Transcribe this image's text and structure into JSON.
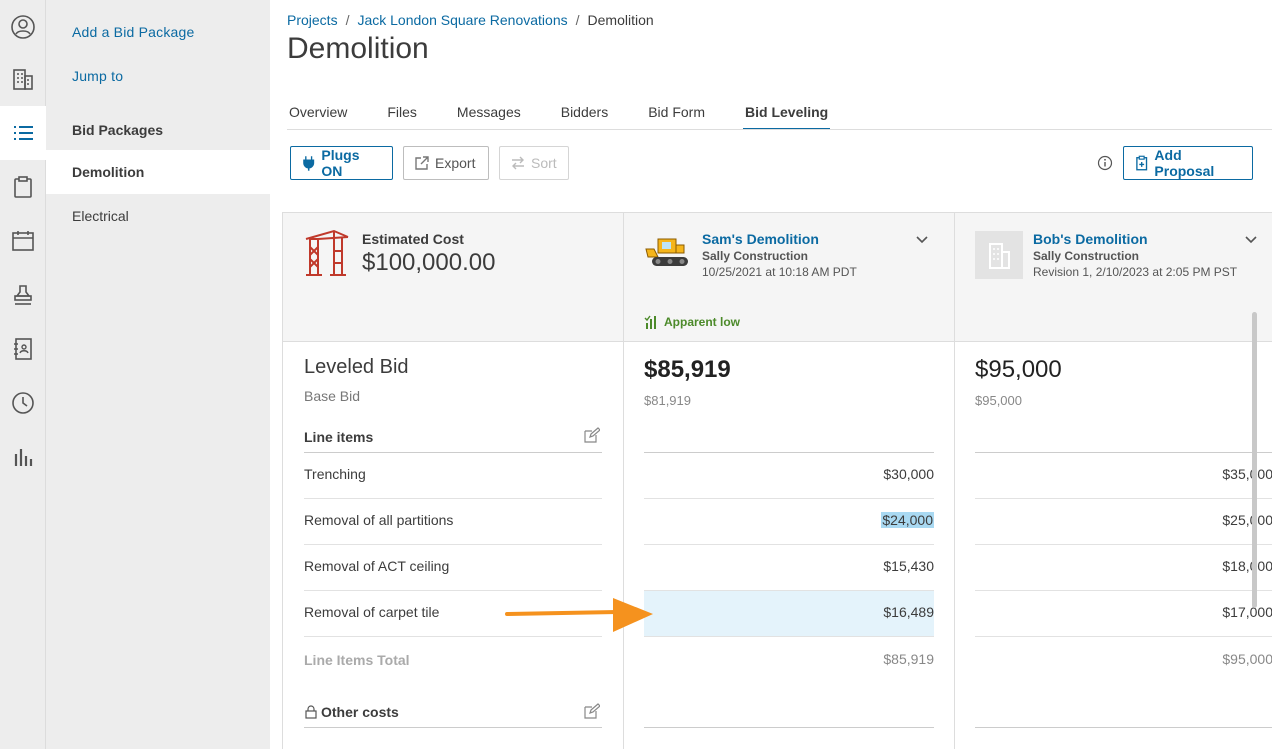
{
  "nav": {
    "icons": [
      "user-circle-icon",
      "building-icon",
      "list-icon",
      "clipboard-icon",
      "calendar-icon",
      "stamp-icon",
      "address-book-icon",
      "clock-icon",
      "bar-chart-icon"
    ]
  },
  "sidebar": {
    "add_bid_package": "Add a Bid Package",
    "jump_to": "Jump to",
    "section_title": "Bid Packages",
    "items": [
      {
        "label": "Demolition"
      },
      {
        "label": "Electrical"
      }
    ]
  },
  "breadcrumb": {
    "projects": "Projects",
    "project": "Jack London Square Renovations",
    "current": "Demolition",
    "separator": "/"
  },
  "page_title": "Demolition",
  "tabs": [
    {
      "label": "Overview"
    },
    {
      "label": "Files"
    },
    {
      "label": "Messages"
    },
    {
      "label": "Bidders"
    },
    {
      "label": "Bid Form"
    },
    {
      "label": "Bid Leveling"
    }
  ],
  "toolbar": {
    "plugs_label": "Plugs ON",
    "export_label": "Export",
    "sort_label": "Sort",
    "add_proposal_label": "Add Proposal"
  },
  "estimate": {
    "label": "Estimated Cost",
    "value": "$100,000.00"
  },
  "bidders": [
    {
      "name": "Sam's Demolition",
      "company": "Sally Construction",
      "date": "10/25/2021 at 10:18 AM PDT",
      "badge": "Apparent low",
      "leveled_total": "$85,919",
      "base_total": "$81,919",
      "line_items": [
        "$30,000",
        "$24,000",
        "$15,430",
        "$16,489"
      ],
      "line_items_total": "$85,919"
    },
    {
      "name": "Bob's Demolition",
      "company": "Sally Construction",
      "date": "Revision 1, 2/10/2023 at 2:05 PM PST",
      "leveled_total": "$95,000",
      "base_total": "$95,000",
      "line_items": [
        "$35,000",
        "$25,000",
        "$18,000",
        "$17,000"
      ],
      "line_items_total": "$95,000"
    }
  ],
  "leveled": {
    "title": "Leveled Bid",
    "subtitle": "Base Bid",
    "line_items_label": "Line items",
    "line_items": [
      {
        "label": "Trenching"
      },
      {
        "label": "Removal of all partitions"
      },
      {
        "label": "Removal of ACT ceiling"
      },
      {
        "label": "Removal of carpet tile"
      }
    ],
    "total_label": "Line Items Total",
    "other_costs_label": "Other costs"
  },
  "colors": {
    "accent": "#0b6aa2",
    "highlight": "#e4f3fb",
    "success": "#4c8a2a",
    "annotation_arrow": "#f5921e"
  }
}
